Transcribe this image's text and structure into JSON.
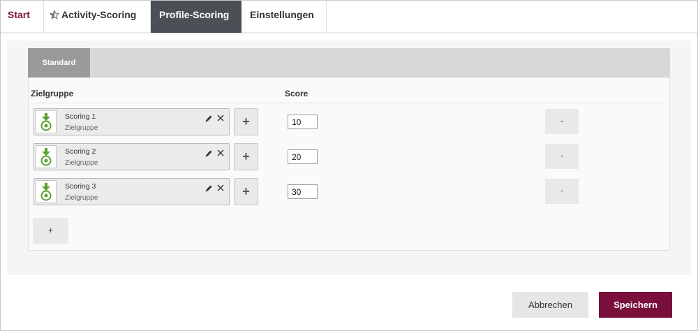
{
  "tabs": {
    "start": "Start",
    "activity": "Activity-Scoring",
    "profile": "Profile-Scoring",
    "settings": "Einstellungen"
  },
  "subtab": "Standard",
  "columns": {
    "group": "Zielgruppe",
    "score": "Score"
  },
  "rows": [
    {
      "title": "Scoring 1",
      "subtitle": "Zielgruppe",
      "add": "+",
      "score": "10",
      "remove": "-"
    },
    {
      "title": "Scoring 2",
      "subtitle": "Zielgruppe",
      "add": "+",
      "score": "20",
      "remove": "-"
    },
    {
      "title": "Scoring 3",
      "subtitle": "Zielgruppe",
      "add": "+",
      "score": "30",
      "remove": "-"
    }
  ],
  "add_row": "+",
  "footer": {
    "cancel": "Abbrechen",
    "save": "Speichern"
  },
  "colors": {
    "accent": "#7a0f3c",
    "active_tab": "#4a5056",
    "icon_green": "#5aa02c"
  }
}
